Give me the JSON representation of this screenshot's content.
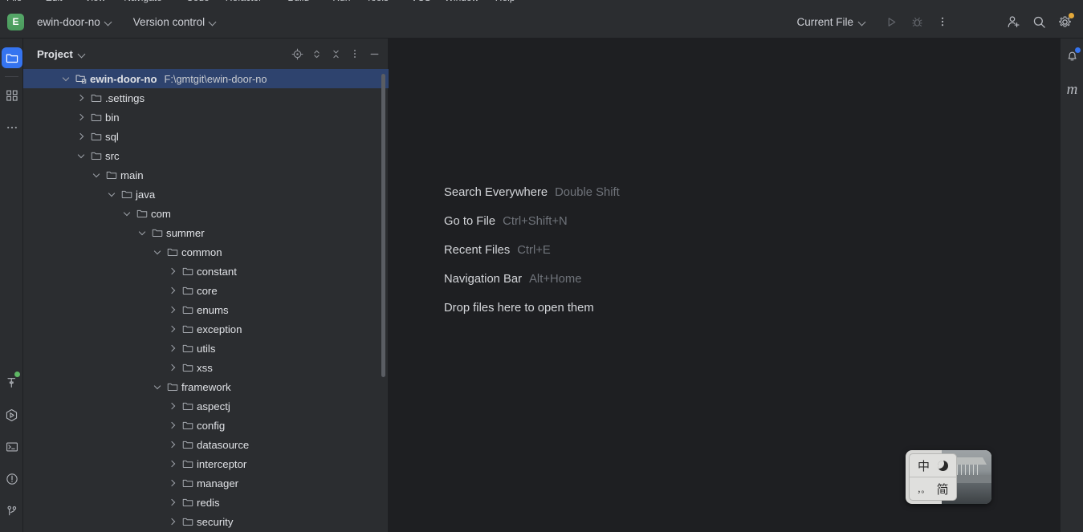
{
  "window": {
    "menu_sliver_items": [
      "File",
      "Edit",
      "View",
      "Navigate",
      "Code",
      "Refactor",
      "Build",
      "Run",
      "Tools",
      "VCS",
      "Window",
      "Help"
    ]
  },
  "toolbar": {
    "project_badge": "E",
    "project_name": "ewin-door-no",
    "version_control_label": "Version control",
    "run_config_label": "Current File",
    "icons": {
      "run": "run-icon",
      "debug": "debug-icon",
      "more": "more-vertical-icon",
      "add_user": "add-user-icon",
      "search": "search-icon",
      "settings": "gear-icon"
    },
    "settings_badge_color": "#e3a83a"
  },
  "left_activity_bar": {
    "top_items": [
      {
        "name": "sidebar-item-project",
        "icon": "folder-icon",
        "active": true
      },
      {
        "name": "sidebar-item-structure",
        "icon": "structure-grid-icon",
        "active": false
      },
      {
        "name": "sidebar-item-more-tools",
        "icon": "more-horizontal-icon",
        "active": false
      }
    ],
    "bottom_items": [
      {
        "name": "sidebar-item-build",
        "icon": "build-hammer-icon",
        "badge_color": "#5fb865"
      },
      {
        "name": "sidebar-item-run",
        "icon": "run-hexagon-icon",
        "badge_color": ""
      },
      {
        "name": "sidebar-item-terminal",
        "icon": "terminal-icon",
        "badge_color": ""
      },
      {
        "name": "sidebar-item-problems",
        "icon": "problems-warning-icon",
        "badge_color": ""
      },
      {
        "name": "sidebar-item-version-control",
        "icon": "git-branch-icon",
        "badge_color": ""
      }
    ]
  },
  "right_activity_bar": {
    "items": [
      {
        "name": "sidebar-item-notifications",
        "icon": "bell-icon",
        "badge_color": "#3574f0"
      },
      {
        "name": "sidebar-item-maven",
        "icon": "maven-m-icon",
        "label": "m"
      }
    ]
  },
  "project_panel": {
    "title": "Project",
    "actions": [
      {
        "name": "select-opened-file-button",
        "icon": "target-icon"
      },
      {
        "name": "expand-collapse-button",
        "icon": "expand-collapse-icon"
      },
      {
        "name": "collapse-all-button",
        "icon": "collapse-all-icon"
      },
      {
        "name": "options-button",
        "icon": "more-vertical-icon"
      },
      {
        "name": "hide-button",
        "icon": "minimize-icon"
      }
    ],
    "tree": [
      {
        "depth": 0,
        "label": "ewin-door-no",
        "path": "F:\\gmtgit\\ewin-door-no",
        "state": "open",
        "selected": true,
        "icon": "module-folder-icon"
      },
      {
        "depth": 1,
        "label": ".settings",
        "path": "",
        "state": "closed",
        "selected": false,
        "icon": "folder-icon"
      },
      {
        "depth": 1,
        "label": "bin",
        "path": "",
        "state": "closed",
        "selected": false,
        "icon": "folder-icon"
      },
      {
        "depth": 1,
        "label": "sql",
        "path": "",
        "state": "closed",
        "selected": false,
        "icon": "folder-icon"
      },
      {
        "depth": 1,
        "label": "src",
        "path": "",
        "state": "open",
        "selected": false,
        "icon": "folder-icon"
      },
      {
        "depth": 2,
        "label": "main",
        "path": "",
        "state": "open",
        "selected": false,
        "icon": "folder-icon"
      },
      {
        "depth": 3,
        "label": "java",
        "path": "",
        "state": "open",
        "selected": false,
        "icon": "folder-icon"
      },
      {
        "depth": 4,
        "label": "com",
        "path": "",
        "state": "open",
        "selected": false,
        "icon": "folder-icon"
      },
      {
        "depth": 5,
        "label": "summer",
        "path": "",
        "state": "open",
        "selected": false,
        "icon": "folder-icon"
      },
      {
        "depth": 6,
        "label": "common",
        "path": "",
        "state": "open",
        "selected": false,
        "icon": "folder-icon"
      },
      {
        "depth": 7,
        "label": "constant",
        "path": "",
        "state": "closed",
        "selected": false,
        "icon": "folder-icon"
      },
      {
        "depth": 7,
        "label": "core",
        "path": "",
        "state": "closed",
        "selected": false,
        "icon": "folder-icon"
      },
      {
        "depth": 7,
        "label": "enums",
        "path": "",
        "state": "closed",
        "selected": false,
        "icon": "folder-icon"
      },
      {
        "depth": 7,
        "label": "exception",
        "path": "",
        "state": "closed",
        "selected": false,
        "icon": "folder-icon"
      },
      {
        "depth": 7,
        "label": "utils",
        "path": "",
        "state": "closed",
        "selected": false,
        "icon": "folder-icon"
      },
      {
        "depth": 7,
        "label": "xss",
        "path": "",
        "state": "closed",
        "selected": false,
        "icon": "folder-icon"
      },
      {
        "depth": 6,
        "label": "framework",
        "path": "",
        "state": "open",
        "selected": false,
        "icon": "folder-icon"
      },
      {
        "depth": 7,
        "label": "aspectj",
        "path": "",
        "state": "closed",
        "selected": false,
        "icon": "folder-icon"
      },
      {
        "depth": 7,
        "label": "config",
        "path": "",
        "state": "closed",
        "selected": false,
        "icon": "folder-icon"
      },
      {
        "depth": 7,
        "label": "datasource",
        "path": "",
        "state": "closed",
        "selected": false,
        "icon": "folder-icon"
      },
      {
        "depth": 7,
        "label": "interceptor",
        "path": "",
        "state": "closed",
        "selected": false,
        "icon": "folder-icon"
      },
      {
        "depth": 7,
        "label": "manager",
        "path": "",
        "state": "closed",
        "selected": false,
        "icon": "folder-icon"
      },
      {
        "depth": 7,
        "label": "redis",
        "path": "",
        "state": "closed",
        "selected": false,
        "icon": "folder-icon"
      },
      {
        "depth": 7,
        "label": "security",
        "path": "",
        "state": "closed",
        "selected": false,
        "icon": "folder-icon"
      }
    ]
  },
  "editor": {
    "hints": [
      {
        "name": "Search Everywhere",
        "shortcut": "Double Shift"
      },
      {
        "name": "Go to File",
        "shortcut": "Ctrl+Shift+N"
      },
      {
        "name": "Recent Files",
        "shortcut": "Ctrl+E"
      },
      {
        "name": "Navigation Bar",
        "shortcut": "Alt+Home"
      },
      {
        "name": "Drop files here to open them",
        "shortcut": ""
      }
    ]
  },
  "ime_widget": {
    "mode_cn": "中",
    "mode_night_icon": "moon-icon",
    "punctuation": "，。",
    "simplified": "简",
    "thumbnail": "pavilion-photo"
  },
  "colors": {
    "accent_blue": "#3574f0",
    "selection_blue": "#2e436e",
    "panel_bg": "#2b2d30",
    "editor_bg": "#1e1f22",
    "text": "#dfe1e5",
    "muted_text": "#6f737a",
    "green_badge": "#56a869"
  }
}
